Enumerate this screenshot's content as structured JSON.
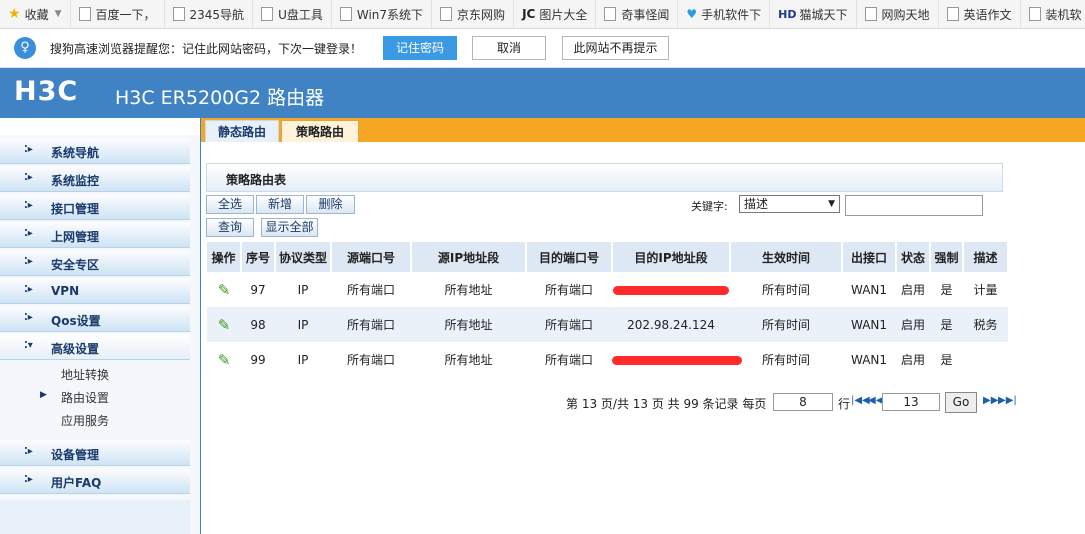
{
  "bookmarks": [
    {
      "label": "收藏",
      "icon": "star-icon"
    },
    {
      "label": "百度一下，",
      "icon": "page-icon"
    },
    {
      "label": "2345导航",
      "icon": "page-icon"
    },
    {
      "label": "U盘工具",
      "icon": "page-icon"
    },
    {
      "label": "Win7系统下",
      "icon": "page-icon"
    },
    {
      "label": "京东网购",
      "icon": "page-icon"
    },
    {
      "label": "图片大全",
      "icon": "jc-logo-icon"
    },
    {
      "label": "奇事怪闻",
      "icon": "page-icon"
    },
    {
      "label": "手机软件下",
      "icon": "heart-icon"
    },
    {
      "label": "猫城天下",
      "icon": "hd-logo-icon"
    },
    {
      "label": "网购天地",
      "icon": "page-icon"
    },
    {
      "label": "英语作文",
      "icon": "page-icon"
    },
    {
      "label": "装机软",
      "icon": "page-icon"
    }
  ],
  "password_bar": {
    "message": "搜狗高速浏览器提醒您：记住此网站密码，下次一键登录！",
    "remember_label": "记住密码",
    "cancel_label": "取消",
    "never_label": "此网站不再提示"
  },
  "header": {
    "logo": "H3C",
    "title": "H3C ER5200G2 路由器"
  },
  "sidebar": {
    "items": [
      {
        "label": "系统导航"
      },
      {
        "label": "系统监控"
      },
      {
        "label": "接口管理"
      },
      {
        "label": "上网管理"
      },
      {
        "label": "安全专区"
      },
      {
        "label": "VPN"
      },
      {
        "label": "Qos设置"
      },
      {
        "label": "高级设置"
      },
      {
        "label": "设备管理"
      },
      {
        "label": "用户FAQ"
      }
    ],
    "subitems": [
      {
        "label": "地址转换"
      },
      {
        "label": "路由设置"
      },
      {
        "label": "应用服务"
      }
    ]
  },
  "tabs": [
    {
      "label": "静态路由"
    },
    {
      "label": "策略路由"
    }
  ],
  "panel": {
    "title": "策略路由表",
    "select_all": "全选",
    "add": "新增",
    "delete": "删除",
    "query": "查询",
    "show_all": "显示全部",
    "keyword_label": "关键字:",
    "keyword_selected": "描述",
    "keyword_value": ""
  },
  "table": {
    "headers": [
      "操作",
      "序号",
      "协议类型",
      "源端口号",
      "源IP地址段",
      "目的端口号",
      "目的IP地址段",
      "生效时间",
      "出接口",
      "状态",
      "强制",
      "描述"
    ],
    "rows": [
      {
        "seq": "97",
        "protocol": "IP",
        "src_port": "所有端口",
        "src_ip": "所有地址",
        "dst_port": "所有端口",
        "dst_ip": "",
        "time": "所有时间",
        "iface": "WAN1",
        "status": "启用",
        "force": "是",
        "desc": "计量"
      },
      {
        "seq": "98",
        "protocol": "IP",
        "src_port": "所有端口",
        "src_ip": "所有地址",
        "dst_port": "所有端口",
        "dst_ip": "202.98.24.124",
        "time": "所有时间",
        "iface": "WAN1",
        "status": "启用",
        "force": "是",
        "desc": "税务"
      },
      {
        "seq": "99",
        "protocol": "IP",
        "src_port": "所有端口",
        "src_ip": "所有地址",
        "dst_port": "所有端口",
        "dst_ip": "",
        "time": "所有时间",
        "iface": "WAN1",
        "status": "启用",
        "force": "是",
        "desc": ""
      }
    ]
  },
  "pagination": {
    "summary": "第 13 页/共 13 页 共 99 条记录 每页",
    "per_page": "8",
    "row_label": "行",
    "page_input": "13",
    "go_label": "Go"
  },
  "colors": {
    "header_blue": "#3f83c4",
    "tab_orange": "#f5a623",
    "redaction": "#ff2a2a",
    "edit_green": "#3a9a1e"
  }
}
